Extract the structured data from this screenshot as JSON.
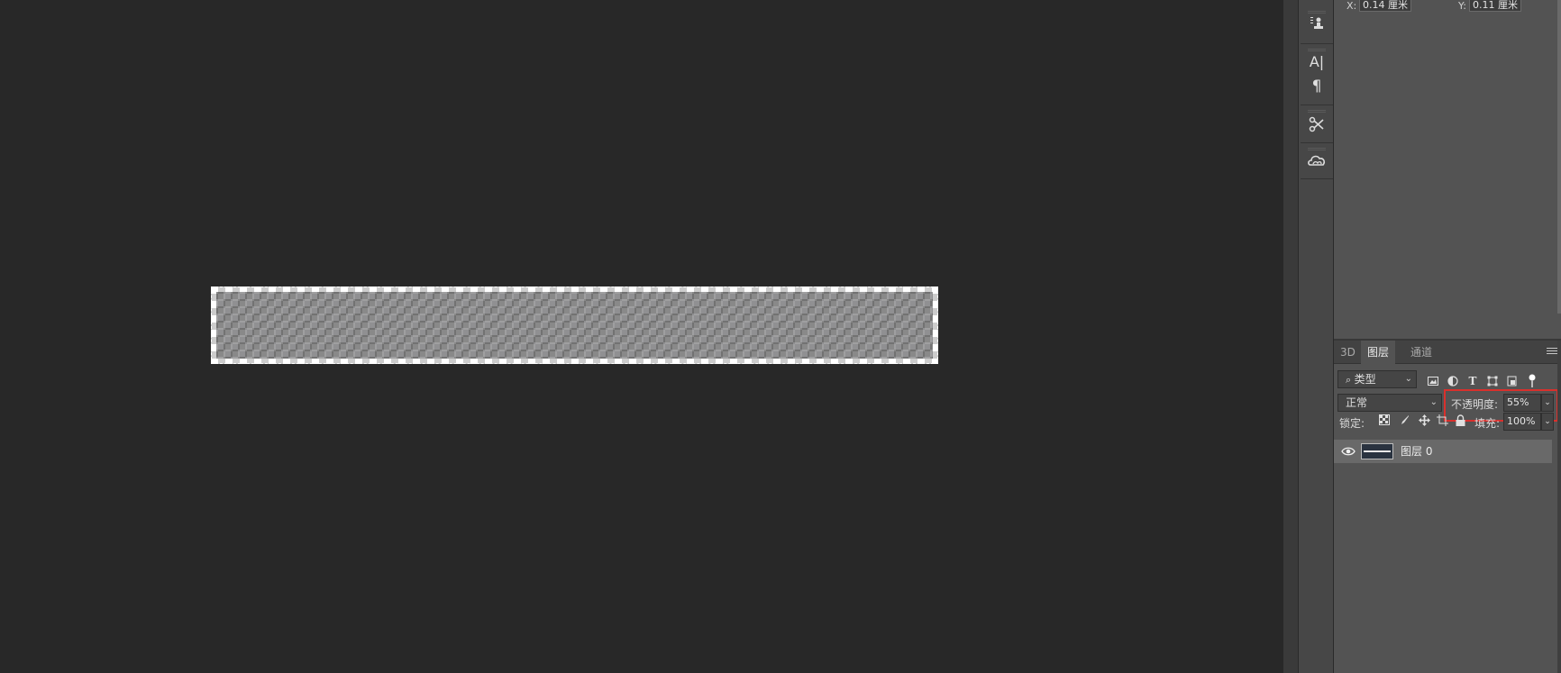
{
  "info": {
    "x_label": "X:",
    "x_value": "0.14 厘米",
    "y_label": "Y:",
    "y_value": "0.11 厘米"
  },
  "toolbar": {
    "icons": [
      "clone-source-icon",
      "character-icon",
      "paragraph-icon",
      "tools-preset-icon",
      "creative-cloud-libraries-icon"
    ]
  },
  "layers_panel": {
    "tabs": [
      {
        "label": "3D",
        "active": false
      },
      {
        "label": "图层",
        "active": true
      },
      {
        "label": "通道",
        "active": false
      }
    ],
    "filter_kind": "类型",
    "blend_mode": "正常",
    "opacity_label": "不透明度:",
    "opacity_value": "55%",
    "lock_label": "锁定:",
    "fill_label": "填充:",
    "fill_value": "100%",
    "layers": [
      {
        "name": "图层 0",
        "visible": true
      }
    ]
  },
  "colors": {
    "highlight_box": "#d9302c",
    "canvas_bg": "#282828",
    "panel_bg": "#535353"
  }
}
